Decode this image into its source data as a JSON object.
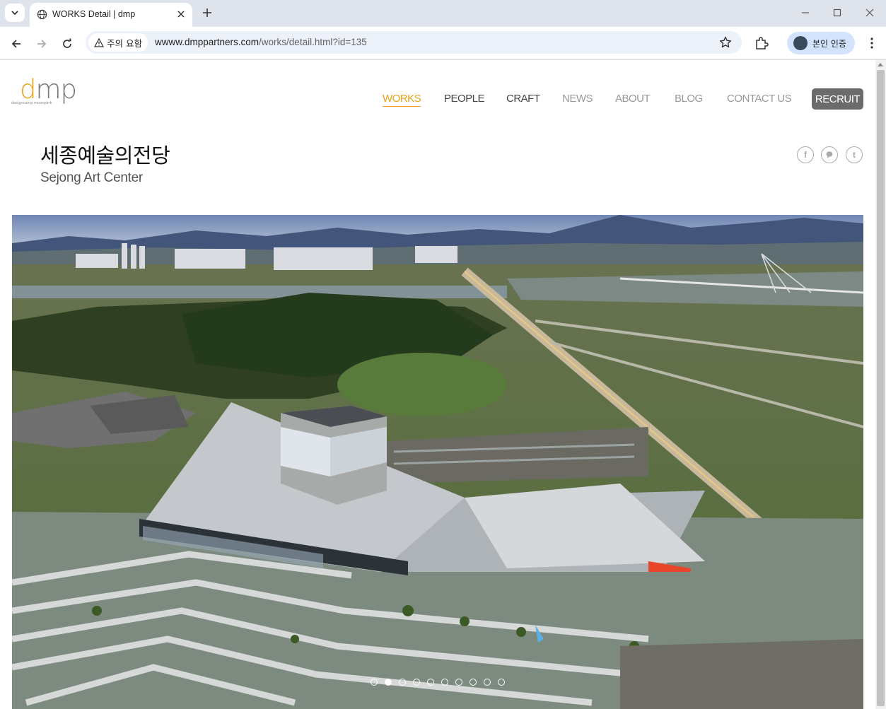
{
  "browser": {
    "tab_title": "WORKS Detail | dmp",
    "security_chip": "주의 요함",
    "url_host": "wwww.dmppartners.com",
    "url_path": "/works/detail.html?id=135",
    "profile_label": "본인 인증"
  },
  "site": {
    "logo_text": "dmp",
    "logo_tagline": "designcamp moonpark",
    "nav": {
      "works": "WORKS",
      "people": "PEOPLE",
      "craft": "CRAFT",
      "news": "NEWS",
      "about": "ABOUT",
      "blog": "BLOG",
      "contact": "CONTACT US",
      "recruit": "RECRUIT"
    },
    "active_nav": "WORKS",
    "accent_color": "#e8a317"
  },
  "project": {
    "title_ko": "세종예술의전당",
    "title_en": "Sejong Art Center"
  },
  "social": {
    "facebook": "f",
    "kakao": "",
    "twitter": "t"
  },
  "slider": {
    "total": 10,
    "active_index": 1
  }
}
